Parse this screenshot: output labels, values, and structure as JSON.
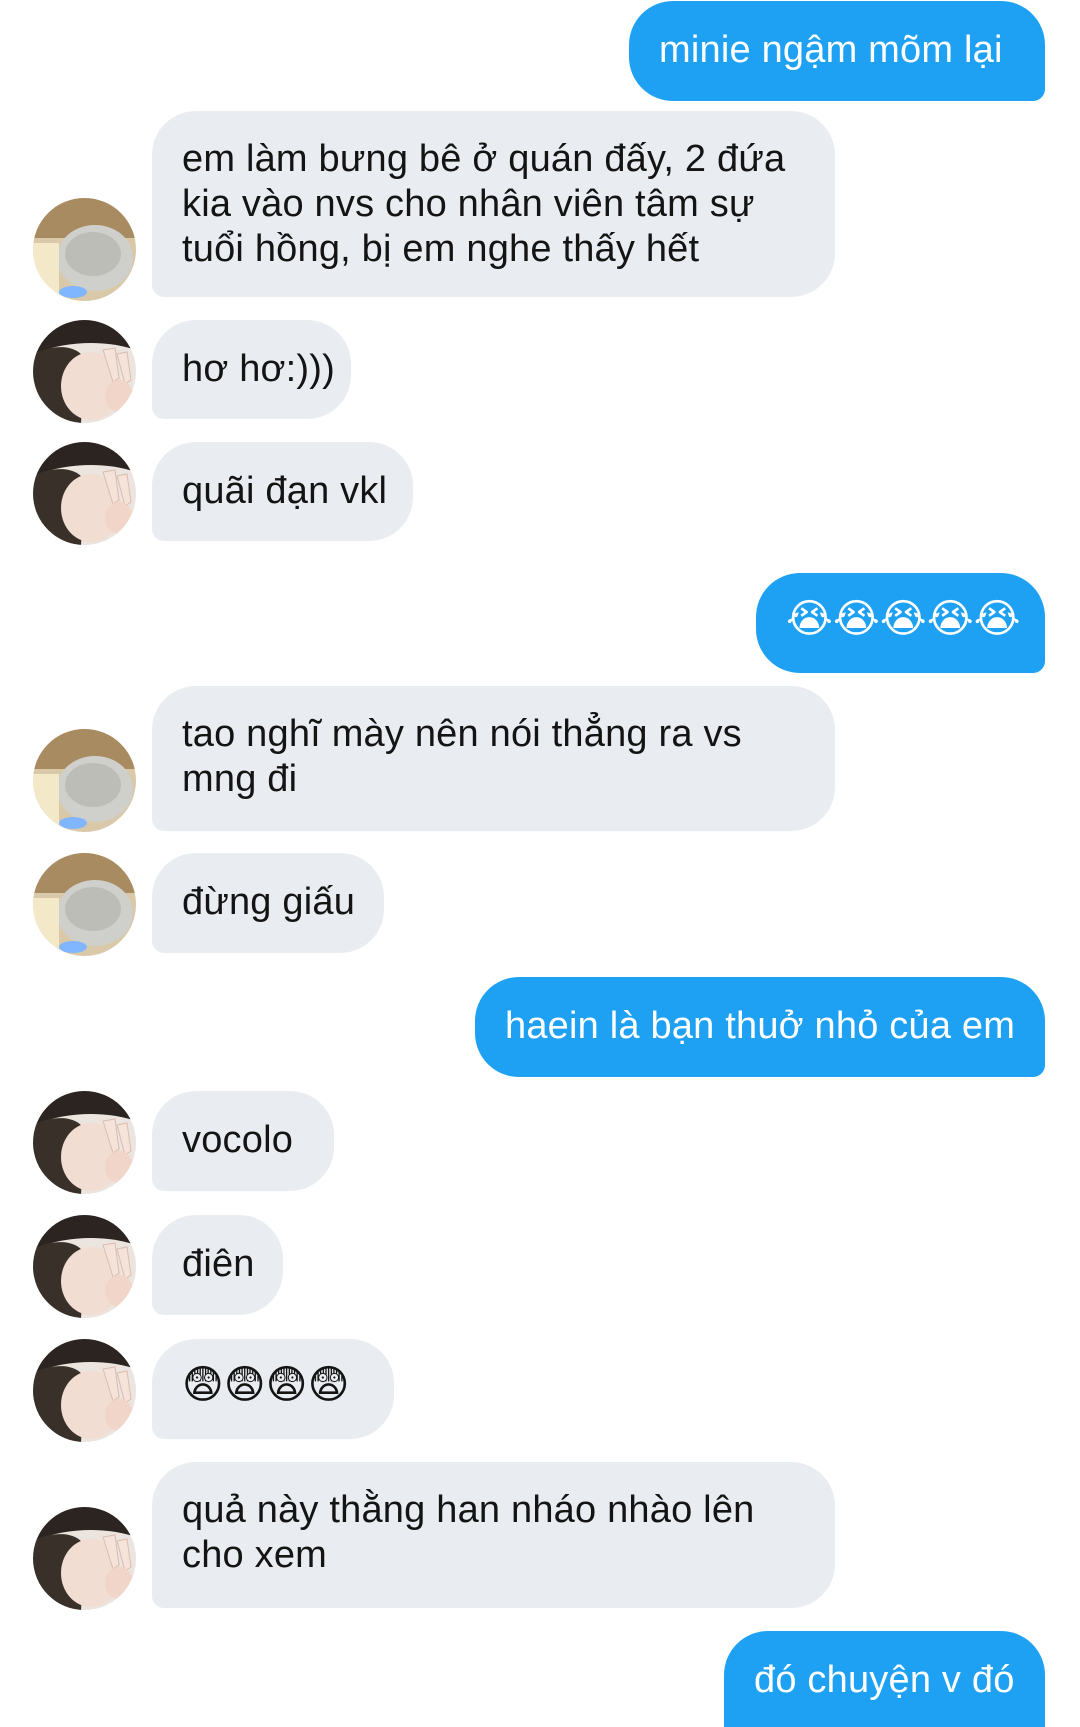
{
  "messages": [
    {
      "side": "out",
      "text": "minie ngậm mõm lại"
    },
    {
      "side": "in",
      "text": "em làm bưng bê ở quán đấy, 2 đứa\nkia vào nvs cho nhân viên tâm sự\ntuổi hồng, bị em nghe thấy hết",
      "avatar": "cat-avatar"
    },
    {
      "side": "in",
      "text": "hơ hơ:)))",
      "avatar": "peace-sign-avatar"
    },
    {
      "side": "in",
      "text": "quãi đạn vkl",
      "avatar": "peace-sign-avatar"
    },
    {
      "side": "out",
      "text": "😭😭😭😭😭"
    },
    {
      "side": "in",
      "text": "tao nghĩ mày nên nói thẳng ra vs\nmng đi",
      "avatar": "cat-avatar"
    },
    {
      "side": "in",
      "text": "đừng giấu",
      "avatar": "cat-avatar"
    },
    {
      "side": "out",
      "text": "haein là bạn thuở nhỏ của em"
    },
    {
      "side": "in",
      "text": "vocolo",
      "avatar": "peace-sign-avatar"
    },
    {
      "side": "in",
      "text": "điên",
      "avatar": "peace-sign-avatar"
    },
    {
      "side": "in",
      "text": "😨😨😨😨",
      "avatar": "peace-sign-avatar"
    },
    {
      "side": "in",
      "text": "quả này thằng han nháo nhào lên\ncho xem",
      "avatar": "peace-sign-avatar"
    },
    {
      "side": "out",
      "text": "đó chuyện v đó"
    }
  ],
  "colors": {
    "outgoing_bubble": "#1ea1f2",
    "incoming_bubble": "#e9ecf0",
    "outgoing_text": "#ffffff",
    "incoming_text": "#141414"
  }
}
